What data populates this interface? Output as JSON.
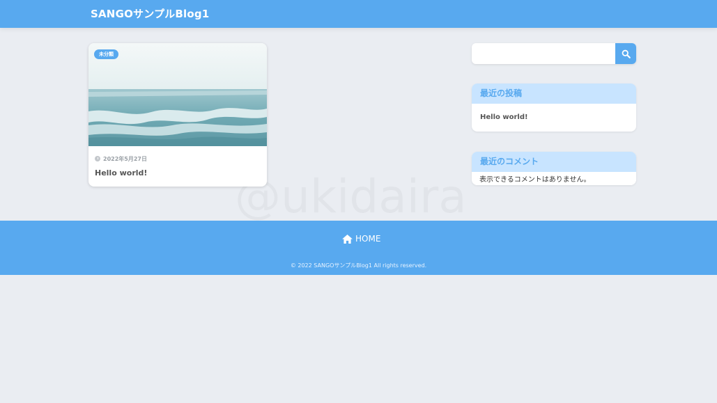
{
  "header": {
    "site_title": "SANGOサンプルBlog1"
  },
  "watermark": "@ukidaira",
  "post_card": {
    "category": "未分類",
    "date": "2022年5月27日",
    "title": "Hello world!",
    "thumbnail_icon": "ocean-waves-image"
  },
  "search": {
    "placeholder": "",
    "button_icon": "search-icon"
  },
  "widgets": {
    "recent_posts": {
      "title": "最近の投稿",
      "items": [
        "Hello world!"
      ]
    },
    "recent_comments": {
      "title": "最近のコメント",
      "empty_text": "表示できるコメントはありません。"
    }
  },
  "footer": {
    "home_label": "HOME",
    "copyright": "© 2022 SANGOサンプルBlog1 All rights reserved."
  },
  "colors": {
    "accent": "#58a9ef",
    "widget_header": "#c8e4ff",
    "background": "#eaedf2"
  }
}
